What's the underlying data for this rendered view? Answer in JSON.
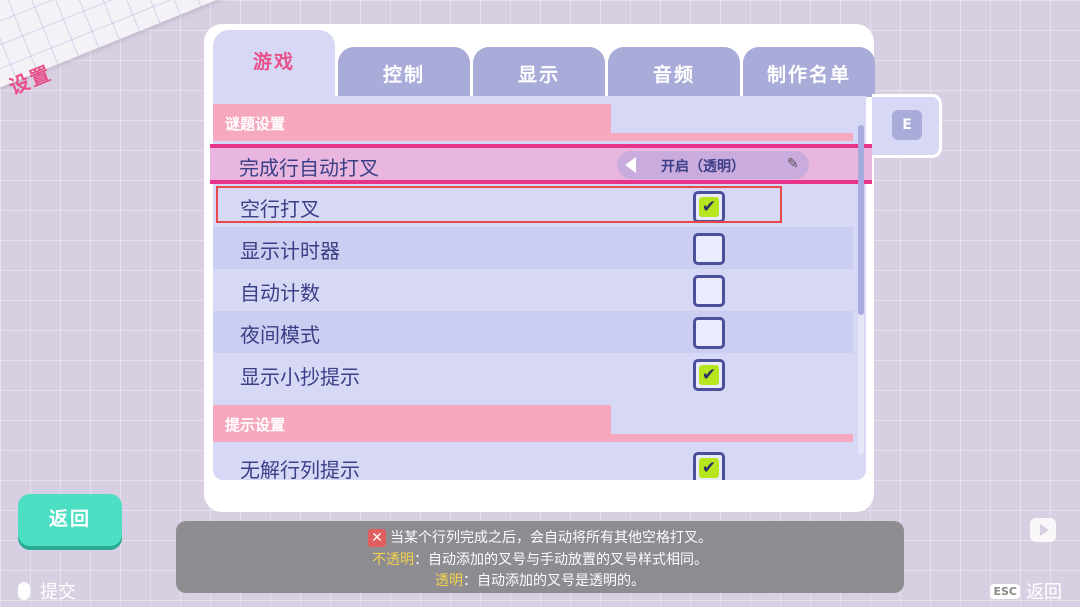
{
  "corner_title": "设置",
  "tabs": [
    {
      "label": "游戏",
      "active": true
    },
    {
      "label": "控制",
      "active": false
    },
    {
      "label": "显示",
      "active": false
    },
    {
      "label": "音频",
      "active": false
    },
    {
      "label": "制作名单",
      "active": false
    }
  ],
  "side_tab_key": "E",
  "sections": {
    "puzzle": "谜题设置",
    "hint": "提示设置"
  },
  "auto_cross": {
    "label": "完成行自动打叉",
    "value": "开启（透明）"
  },
  "rows": [
    {
      "label": "空行打叉",
      "checked": true
    },
    {
      "label": "显示计时器",
      "checked": false
    },
    {
      "label": "自动计数",
      "checked": false
    },
    {
      "label": "夜间模式",
      "checked": false
    },
    {
      "label": "显示小抄提示",
      "checked": true
    }
  ],
  "hint_rows": [
    {
      "label": "无解行列提示",
      "checked": true
    }
  ],
  "back_button": "返回",
  "hint": {
    "line1": "当某个行列完成之后，会自动将所有其他空格打叉。",
    "line2_key": "不透明",
    "line2_text": "：自动添加的叉号与手动放置的叉号样式相同。",
    "line3_key": "透明",
    "line3_text": "：自动添加的叉号是透明的。"
  },
  "footer": {
    "submit": "提交",
    "esc_key": "ESC",
    "back": "返回"
  },
  "colors": {
    "accent_pink": "#e8508a",
    "tab_inactive": "#a9acd9",
    "panel_bg": "#d6d8f6",
    "back_button": "#4ddfc3",
    "check_fill": "#b7e51e"
  }
}
